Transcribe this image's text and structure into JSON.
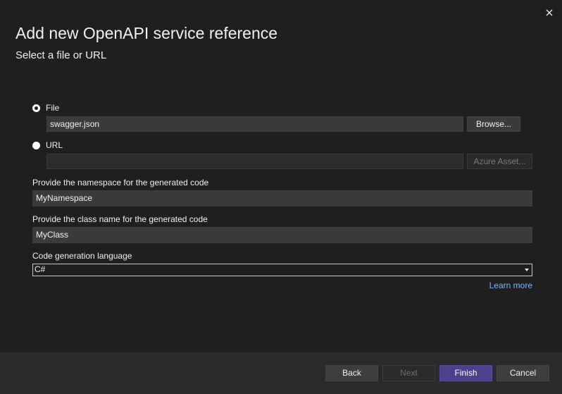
{
  "dialog": {
    "title": "Add new OpenAPI service reference",
    "subtitle": "Select a file or URL"
  },
  "source": {
    "file_label": "File",
    "file_value": "swagger.json",
    "browse_label": "Browse...",
    "url_label": "URL",
    "url_value": "",
    "azure_label": "Azure Asset..."
  },
  "namespace": {
    "label": "Provide the namespace for the generated code",
    "value": "MyNamespace"
  },
  "classname": {
    "label": "Provide the class name for the generated code",
    "value": "MyClass"
  },
  "language": {
    "label": "Code generation language",
    "selected": "C#"
  },
  "learn_more": "Learn more",
  "footer": {
    "back": "Back",
    "next": "Next",
    "finish": "Finish",
    "cancel": "Cancel"
  },
  "colors": {
    "background": "#1f1f1f",
    "footer": "#2b2b2b",
    "primary": "#4e3f8f",
    "link": "#7ab6ff"
  }
}
